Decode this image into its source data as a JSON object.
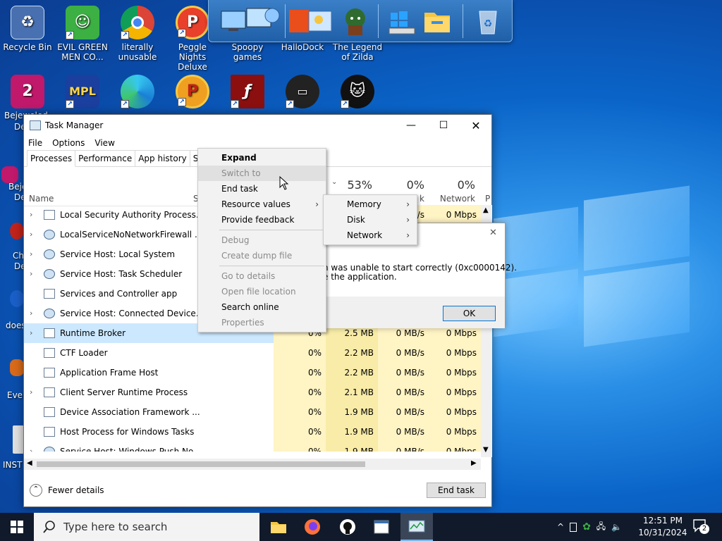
{
  "desktop": {
    "icons": [
      {
        "label": "Recycle Bin"
      },
      {
        "label": "EVIL GREEN MEN CO..."
      },
      {
        "label": "literally unusable"
      },
      {
        "label": "Peggle Nights Deluxe"
      },
      {
        "label": "Spoopy games"
      },
      {
        "label": "HalloDock"
      },
      {
        "label": "The Legend of Zilda"
      }
    ],
    "partial_labels": [
      "Bejeweled",
      "De",
      "Beje",
      "De",
      "Ch",
      "De",
      "does",
      "Ever",
      "INST"
    ]
  },
  "task_manager": {
    "title": "Task Manager",
    "menu": [
      "File",
      "Options",
      "View"
    ],
    "tabs": [
      "Processes",
      "Performance",
      "App history",
      "Start"
    ],
    "header": {
      "name_label": "Name",
      "status_label": "S",
      "memory_pct": "53%",
      "disk_pct": "0%",
      "disk_label": "k",
      "network_pct": "0%",
      "network_label": "Network",
      "power_label": "P"
    },
    "processes": [
      {
        "name": "Local Security Authority Process...",
        "cpu": "",
        "memory": "",
        "disk": "/s",
        "network": "0 Mbps",
        "expandable": true
      },
      {
        "name": "LocalServiceNoNetworkFirewall ...",
        "cpu": "",
        "memory": "",
        "disk": "",
        "network": "",
        "expandable": true
      },
      {
        "name": "Service Host: Local System",
        "cpu": "",
        "memory": "",
        "disk": "",
        "network": "",
        "expandable": true
      },
      {
        "name": "Service Host: Task Scheduler",
        "cpu": "",
        "memory": "",
        "disk": "",
        "network": "",
        "expandable": true
      },
      {
        "name": "Services and Controller app",
        "cpu": "",
        "memory": "",
        "disk": "",
        "network": "",
        "expandable": false
      },
      {
        "name": "Service Host: Connected Device...",
        "cpu": "",
        "memory": "",
        "disk": "",
        "network": "",
        "expandable": true
      },
      {
        "name": "Runtime Broker",
        "cpu": "0%",
        "memory": "2.5 MB",
        "disk": "0 MB/s",
        "network": "0 Mbps",
        "expandable": true
      },
      {
        "name": "CTF Loader",
        "cpu": "0%",
        "memory": "2.2 MB",
        "disk": "0 MB/s",
        "network": "0 Mbps",
        "expandable": false
      },
      {
        "name": "Application Frame Host",
        "cpu": "0%",
        "memory": "2.2 MB",
        "disk": "0 MB/s",
        "network": "0 Mbps",
        "expandable": false
      },
      {
        "name": "Client Server Runtime Process",
        "cpu": "0%",
        "memory": "2.1 MB",
        "disk": "0 MB/s",
        "network": "0 Mbps",
        "expandable": true
      },
      {
        "name": "Device Association Framework ...",
        "cpu": "0%",
        "memory": "1.9 MB",
        "disk": "0 MB/s",
        "network": "0 Mbps",
        "expandable": false
      },
      {
        "name": "Host Process for Windows Tasks",
        "cpu": "0%",
        "memory": "1.9 MB",
        "disk": "0 MB/s",
        "network": "0 Mbps",
        "expandable": false
      },
      {
        "name": "Service Host: Windows Push No...",
        "cpu": "0%",
        "memory": "1.9 MB",
        "disk": "0 MB/s",
        "network": "0 Mbps",
        "expandable": true
      }
    ],
    "fewer_details": "Fewer details",
    "end_task": "End task"
  },
  "error_dialog": {
    "line1": "n was unable to start correctly (0xc0000142).",
    "line2": "e the application.",
    "ok": "OK"
  },
  "context_menu": {
    "items": [
      {
        "label": "Expand",
        "enabled": true,
        "bold": true
      },
      {
        "label": "Switch to",
        "enabled": false
      },
      {
        "label": "End task",
        "enabled": true
      },
      {
        "label": "Resource values",
        "enabled": true,
        "submenu": true
      },
      {
        "label": "Provide feedback",
        "enabled": true
      },
      {
        "label": "Debug",
        "enabled": false
      },
      {
        "label": "Create dump file",
        "enabled": false
      },
      {
        "label": "Go to details",
        "enabled": false
      },
      {
        "label": "Open file location",
        "enabled": false
      },
      {
        "label": "Search online",
        "enabled": true
      },
      {
        "label": "Properties",
        "enabled": false
      }
    ],
    "submenu": [
      "Memory",
      "Disk",
      "Network"
    ]
  },
  "taskbar": {
    "search_placeholder": "Type here to search",
    "time": "12:51 PM",
    "date": "10/31/2024",
    "notifications": "2"
  }
}
